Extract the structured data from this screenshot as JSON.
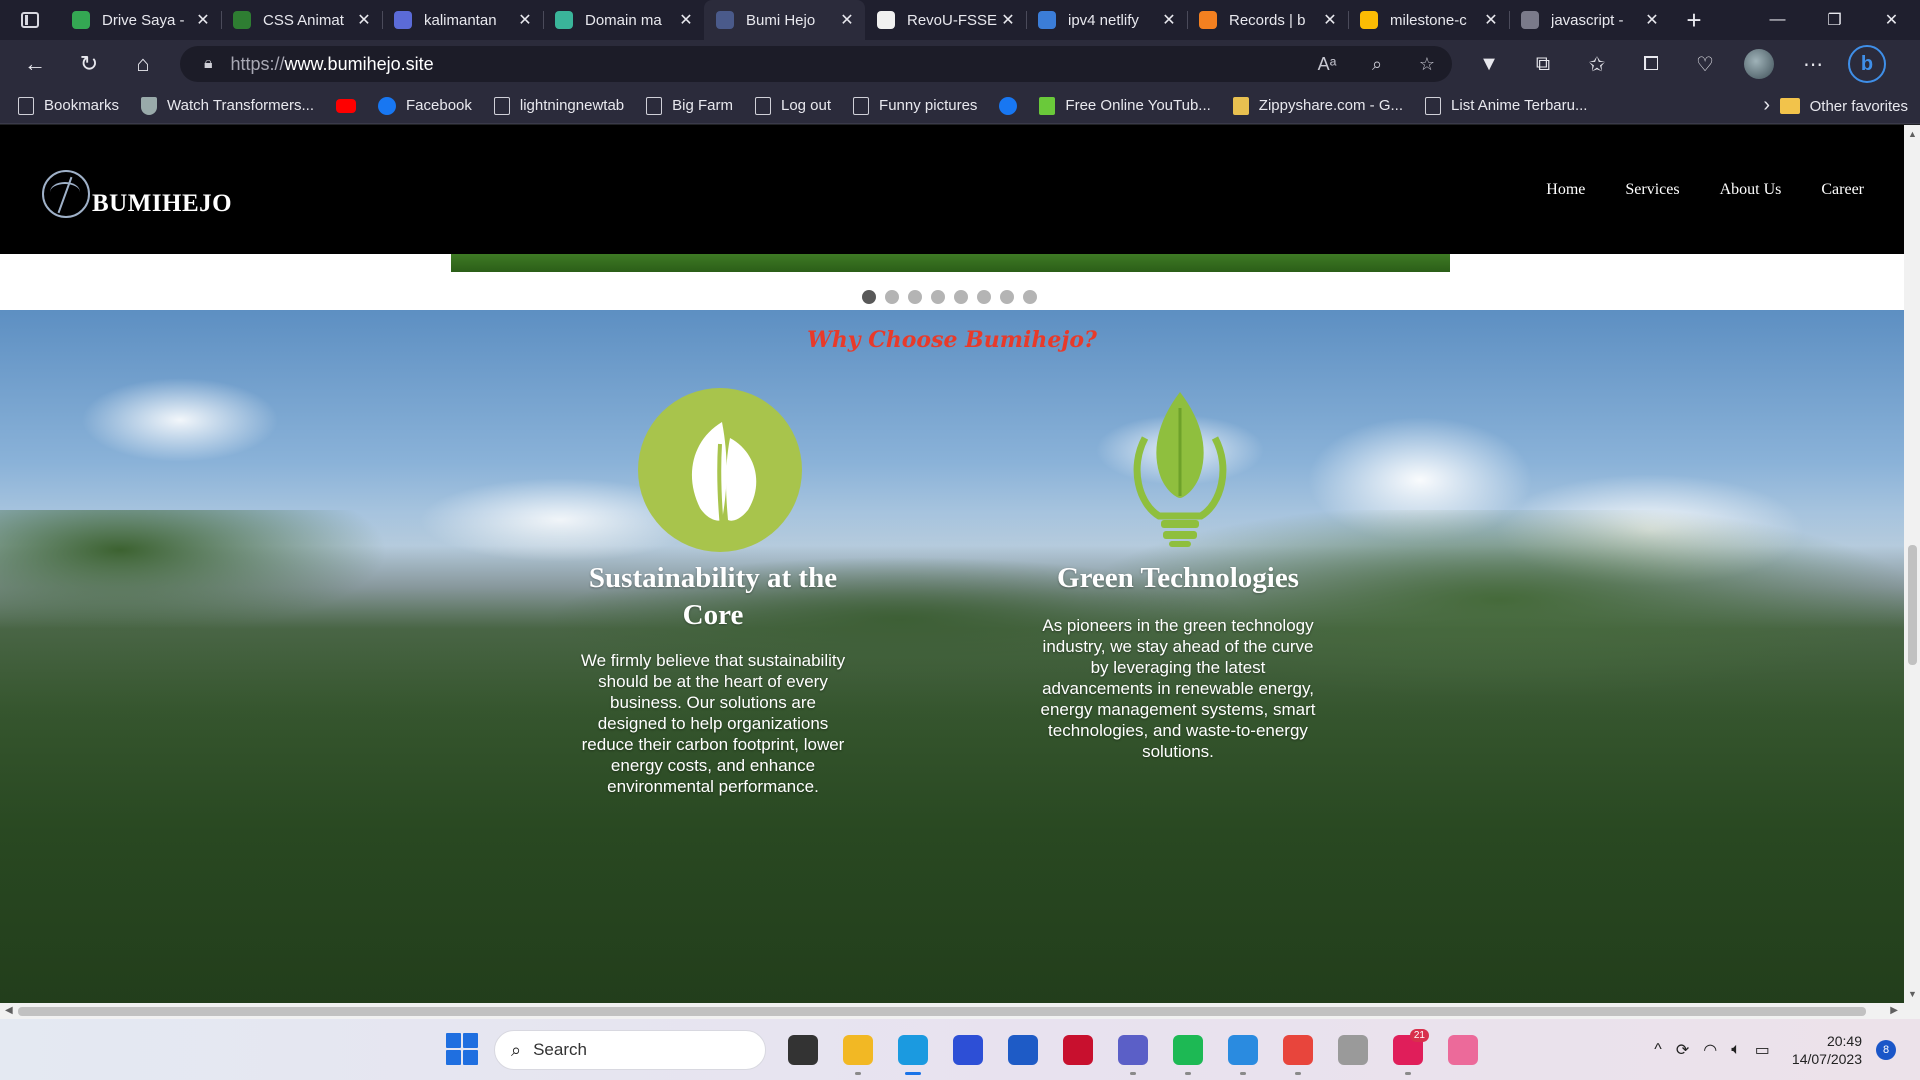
{
  "browser": {
    "tabs": [
      {
        "title": "Drive Saya -",
        "favicon_color": "#34a853"
      },
      {
        "title": "CSS Animat",
        "favicon_color": "#2e7d32"
      },
      {
        "title": "kalimantan",
        "favicon_color": "#5b6bd8"
      },
      {
        "title": "Domain ma",
        "favicon_color": "#3ab59a"
      },
      {
        "title": "Bumi Hejo",
        "favicon_color": "#4a5a8a",
        "active": true
      },
      {
        "title": "RevoU-FSSE",
        "favicon_color": "#f0f0f0"
      },
      {
        "title": "ipv4 netlify",
        "favicon_color": "#3b7dd8"
      },
      {
        "title": "Records | b",
        "favicon_color": "#f38020"
      },
      {
        "title": "milestone-c",
        "favicon_color": "#fbbc04"
      },
      {
        "title": "javascript -",
        "favicon_color": "#7a7a8a"
      }
    ],
    "close_glyph": "✕",
    "new_tab_glyph": "+",
    "window_controls": {
      "minimize": "—",
      "restore": "❐",
      "close": "✕"
    },
    "address": {
      "scheme": "https://",
      "host": "www.bumihejo.site"
    },
    "nav": {
      "back": "←",
      "reload": "↻",
      "home": "⌂"
    },
    "toolbar_icons": [
      "read-aloud-icon",
      "zoom-icon",
      "favorite-star-icon",
      "extension-v-icon",
      "extensions-icon",
      "favorites-icon",
      "collections-icon",
      "browser-essentials-icon",
      "profile-avatar",
      "more-icon",
      "bing-copilot-icon"
    ],
    "bookmarks": [
      {
        "label": "Bookmarks",
        "icon": "page"
      },
      {
        "label": "Watch Transformers...",
        "icon": "tf"
      },
      {
        "label": "",
        "icon": "yt"
      },
      {
        "label": "Facebook",
        "icon": "round"
      },
      {
        "label": "lightningnewtab",
        "icon": "page"
      },
      {
        "label": "Big Farm",
        "icon": "page"
      },
      {
        "label": "Log out",
        "icon": "page"
      },
      {
        "label": "Funny pictures",
        "icon": "page"
      },
      {
        "label": "",
        "icon": "round"
      },
      {
        "label": "Free Online YouTub...",
        "icon": "green"
      },
      {
        "label": "Zippyshare.com - G...",
        "icon": "zip"
      },
      {
        "label": "List Anime Terbaru...",
        "icon": "page"
      }
    ],
    "bookmarks_more": "›",
    "other_favorites": "Other favorites"
  },
  "site": {
    "logo_text": "BUMIHEJO",
    "nav": [
      "Home",
      "Services",
      "About Us",
      "Career"
    ],
    "carousel_dots": 8,
    "carousel_active_index": 0,
    "section_heading": "Why Choose Bumihejo?",
    "features": [
      {
        "title": "Sustainability at the Core",
        "description": "We firmly believe that sustainability should be at the heart of every business. Our solutions are designed to help organizations reduce their carbon footprint, lower energy costs, and enhance environmental performance.",
        "icon": "leaf-circle-icon"
      },
      {
        "title": "Green Technologies",
        "description": "As pioneers in the green technology industry, we stay ahead of the curve by leveraging the latest advancements in renewable energy, energy management systems, smart technologies, and waste-to-energy solutions.",
        "icon": "leaf-bulb-icon"
      }
    ],
    "colors": {
      "heading": "#e83a2a",
      "icon_green": "#a8c44c",
      "header_bg": "#000000"
    }
  },
  "taskbar": {
    "search_placeholder": "Search",
    "apps": [
      {
        "name": "task-view",
        "color": "#333333",
        "state": ""
      },
      {
        "name": "file-explorer",
        "color": "#f2b824",
        "state": "open"
      },
      {
        "name": "edge",
        "color": "#1b9ae0",
        "state": "active"
      },
      {
        "name": "app-blue",
        "color": "#2d4fd6",
        "state": ""
      },
      {
        "name": "store",
        "color": "#1e5bc6",
        "state": ""
      },
      {
        "name": "mcafee",
        "color": "#c8102e",
        "state": ""
      },
      {
        "name": "teams",
        "color": "#5b5fc7",
        "state": "open"
      },
      {
        "name": "spotify",
        "color": "#1db954",
        "state": "open"
      },
      {
        "name": "vscode",
        "color": "#2a8be0",
        "state": "open"
      },
      {
        "name": "chrome",
        "color": "#e8453c",
        "state": "open"
      },
      {
        "name": "app-ring",
        "color": "#9a9a9a",
        "state": ""
      },
      {
        "name": "slack",
        "color": "#e01e5a",
        "state": "open",
        "badge": "21"
      },
      {
        "name": "snipping",
        "color": "#ec6a9a",
        "state": ""
      }
    ],
    "tray": {
      "chevron": "^",
      "time": "20:49",
      "date": "14/07/2023",
      "notifications": "8"
    }
  }
}
